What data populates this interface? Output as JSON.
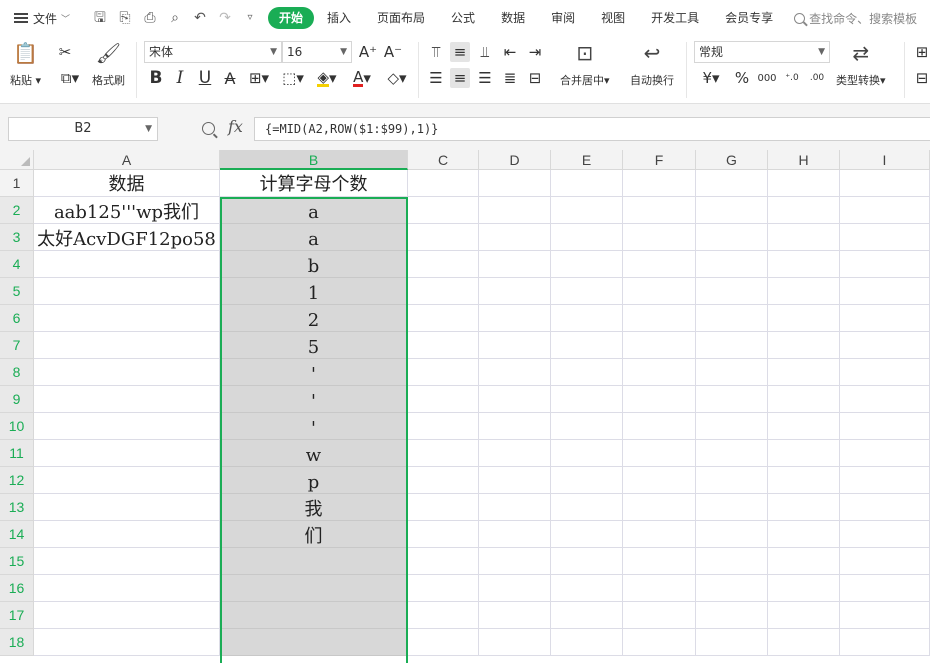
{
  "menu": {
    "file_label": "文件",
    "tabs": [
      "开始",
      "插入",
      "页面布局",
      "公式",
      "数据",
      "审阅",
      "视图",
      "开发工具",
      "会员专享"
    ],
    "search_placeholder": "查找命令、搜索模板"
  },
  "ribbon": {
    "paste_label": "粘贴",
    "format_painter_label": "格式刷",
    "font_name": "宋体",
    "font_size": "16",
    "merge_center_label": "合并居中",
    "wrap_label": "自动换行",
    "number_format": "常规",
    "type_convert_label": "类型转换",
    "accent_color": "#1aad55",
    "font_color": "#e02020",
    "fill_color": "#f5d000"
  },
  "formula_bar": {
    "name_box": "B2",
    "fx_label": "fx",
    "formula": "{=MID(A2,ROW($1:$99),1)}"
  },
  "sheet": {
    "columns": [
      "A",
      "B",
      "C",
      "D",
      "E",
      "F",
      "G",
      "H",
      "I"
    ],
    "selected_column": "B",
    "rows": [
      "1",
      "2",
      "3",
      "4",
      "5",
      "6",
      "7",
      "8",
      "9",
      "10",
      "11",
      "12",
      "13",
      "14",
      "15",
      "16",
      "17",
      "18"
    ],
    "colA": [
      "数据",
      "aab125'''wp我们",
      "太好AcvDGF12po58",
      "",
      "",
      "",
      "",
      "",
      "",
      "",
      "",
      "",
      "",
      "",
      "",
      "",
      "",
      ""
    ],
    "colB": [
      "计算字母个数",
      "a",
      "a",
      "b",
      "1",
      "2",
      "5",
      "'",
      "'",
      "'",
      "w",
      "p",
      "我",
      "们",
      "",
      "",
      "",
      ""
    ]
  }
}
